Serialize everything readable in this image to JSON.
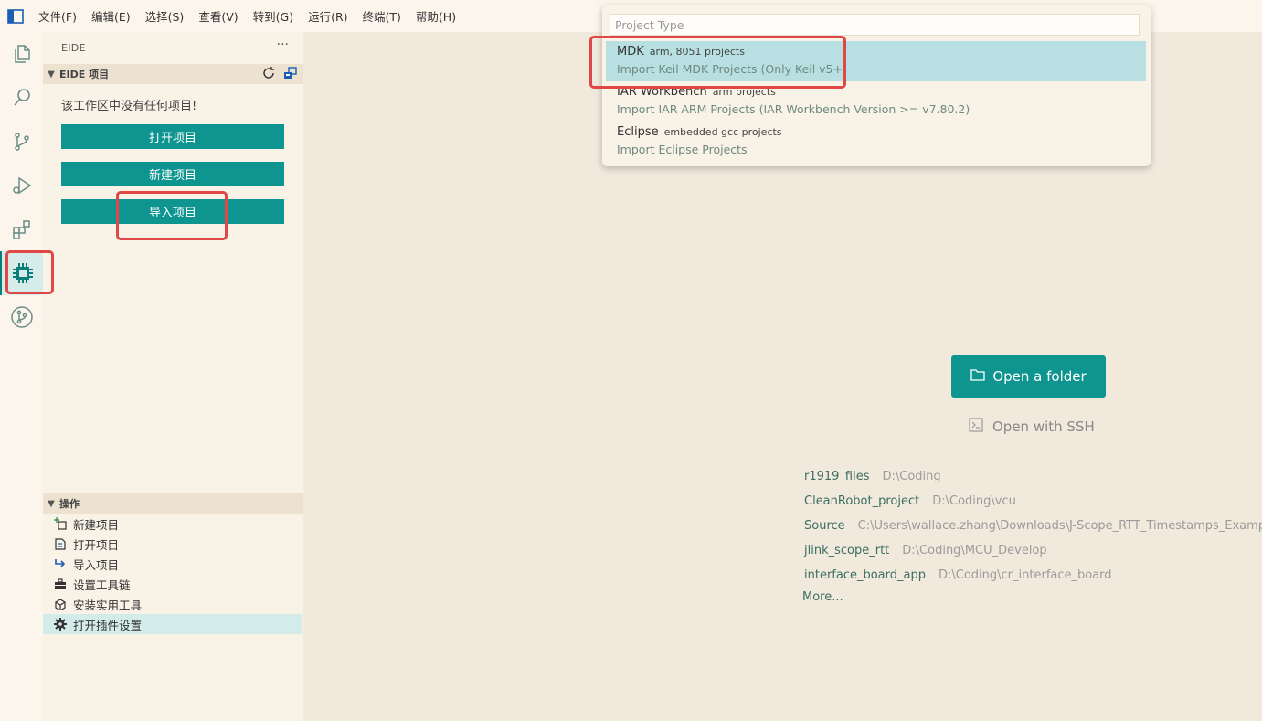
{
  "menubar": {
    "items": [
      "文件(F)",
      "编辑(E)",
      "选择(S)",
      "查看(V)",
      "转到(G)",
      "运行(R)",
      "终端(T)",
      "帮助(H)"
    ]
  },
  "activitybar": {
    "icons": [
      "explorer-icon",
      "search-icon",
      "source-control-icon",
      "run-debug-icon",
      "extensions-icon",
      "eide-chip-icon",
      "git-graph-icon"
    ],
    "active": "eide-chip-icon"
  },
  "sidebar": {
    "title": "EIDE",
    "more": "···",
    "projects_section": {
      "title": "EIDE 项目",
      "empty_message": "该工作区中没有任何项目!",
      "buttons": [
        "打开项目",
        "新建项目",
        "导入项目"
      ]
    },
    "operations_section": {
      "title": "操作",
      "items": [
        {
          "label": "新建项目",
          "icon": "new-project-icon"
        },
        {
          "label": "打开项目",
          "icon": "open-project-icon"
        },
        {
          "label": "导入项目",
          "icon": "import-project-icon"
        },
        {
          "label": "设置工具链",
          "icon": "toolbox-icon"
        },
        {
          "label": "安装实用工具",
          "icon": "install-tool-icon"
        },
        {
          "label": "打开插件设置",
          "icon": "gear-icon"
        }
      ]
    }
  },
  "quickpick": {
    "placeholder": "Project Type",
    "items": [
      {
        "label": "MDK",
        "description": "arm, 8051 projects",
        "detail": "Import Keil MDK Projects (Only Keil v5+)"
      },
      {
        "label": "IAR Workbench",
        "description": "arm projects",
        "detail": "Import IAR ARM Projects (IAR Workbench Version >= v7.80.2)"
      },
      {
        "label": "Eclipse",
        "description": "embedded gcc projects",
        "detail": "Import Eclipse Projects"
      }
    ]
  },
  "welcome": {
    "open_folder": "Open a folder",
    "open_ssh": "Open with SSH",
    "recent": [
      {
        "name": "r1919_files",
        "path": "D:\\Coding"
      },
      {
        "name": "CleanRobot_project",
        "path": "D:\\Coding\\vcu"
      },
      {
        "name": "Source",
        "path": "C:\\Users\\wallace.zhang\\Downloads\\J-Scope_RTT_Timestamps_Example"
      },
      {
        "name": "jlink_scope_rtt",
        "path": "D:\\Coding\\MCU_Develop"
      },
      {
        "name": "interface_board_app",
        "path": "D:\\Coding\\cr_interface_board"
      }
    ],
    "more": "More..."
  },
  "colors": {
    "accent": "#0f9590",
    "highlight": "#e04848",
    "background": "#f0e9dc",
    "sidebar": "#f8f2e7"
  }
}
